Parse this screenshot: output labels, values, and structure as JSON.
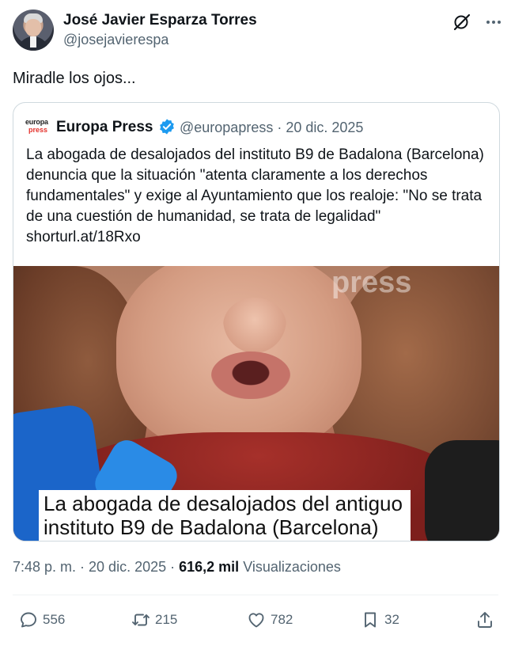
{
  "author": {
    "name": "José Javier Esparza Torres",
    "handle": "@josejavierespa"
  },
  "icons": {
    "grok": "grok-icon",
    "more": "more-icon",
    "verified": "verified-badge-icon",
    "reply": "reply-icon",
    "retweet": "retweet-icon",
    "like": "heart-icon",
    "bookmark": "bookmark-icon",
    "share": "share-icon"
  },
  "tweet": {
    "text": "Miradle los ojos..."
  },
  "quote": {
    "logo_line1": "europa",
    "logo_line2": "press",
    "name": "Europa Press",
    "handle_date": "@europapress · 20 dic. 2025",
    "text": "La abogada de desalojados del instituto B9 de Badalona (Barcelona) denuncia que la situación \"atenta claramente a los derechos fundamentales\" y exige al Ayuntamiento que los realoje: \"No se trata de una cuestión de humanidad, se trata de legalidad\" shorturl.at/18Rxo",
    "media": {
      "watermark": "press",
      "caption_line1": "La abogada de desalojados del antiguo",
      "caption_line2": "instituto B9 de Badalona (Barcelona)"
    }
  },
  "meta": {
    "time_date": "7:48 p. m. · 20 dic. 2025 · ",
    "views_count": "616,2 mil",
    "views_label": " Visualizaciones"
  },
  "actions": {
    "replies": "556",
    "retweets": "215",
    "likes": "782",
    "bookmarks": "32"
  },
  "colors": {
    "text_primary": "#0f1419",
    "text_secondary": "#536471",
    "verified": "#1d9bf0",
    "border": "#cfd9de"
  }
}
